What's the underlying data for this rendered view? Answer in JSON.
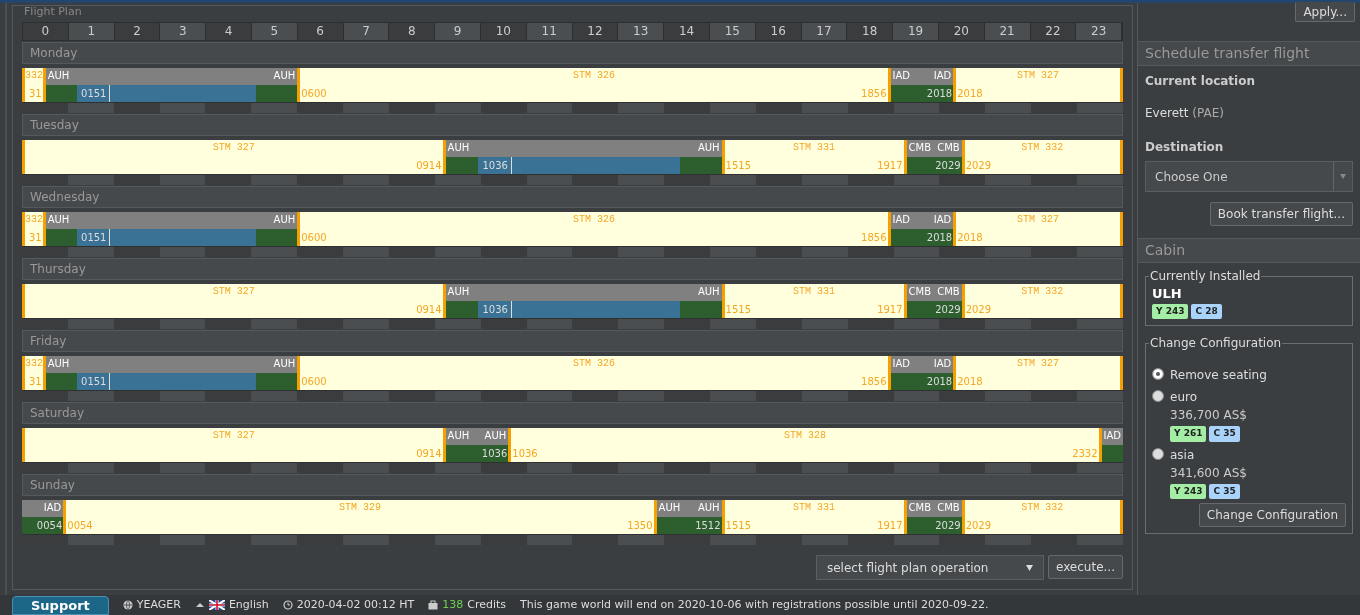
{
  "panel_title": "Flight Plan",
  "hours": [
    "0",
    "1",
    "2",
    "3",
    "4",
    "5",
    "6",
    "7",
    "8",
    "9",
    "10",
    "11",
    "12",
    "13",
    "14",
    "15",
    "16",
    "17",
    "18",
    "19",
    "20",
    "21",
    "22",
    "23"
  ],
  "days": [
    {
      "name": "Monday",
      "segments": [
        {
          "kind": "flight",
          "number": "332",
          "arrival": "31"
        },
        {
          "kind": "ground",
          "airport_in": "AUH",
          "airport_out": "AUH",
          "maintenance": "0151"
        },
        {
          "kind": "flight",
          "number": "STM 326",
          "departure": "0600",
          "arrival": "1856"
        },
        {
          "kind": "ground",
          "airport_in": "IAD",
          "airport_out": "IAD",
          "departure": "2018"
        },
        {
          "kind": "flight",
          "number": "STM 327",
          "departure": "2018"
        }
      ]
    },
    {
      "name": "Tuesday",
      "segments": [
        {
          "kind": "flight",
          "number": "STM 327",
          "arrival": "0914"
        },
        {
          "kind": "ground",
          "airport_in": "AUH",
          "airport_out": "AUH",
          "maintenance": "1036"
        },
        {
          "kind": "flight",
          "number": "STM 331",
          "departure": "1515",
          "arrival": "1917"
        },
        {
          "kind": "ground",
          "airport_in": "CMB",
          "airport_out": "CMB",
          "departure": "2029"
        },
        {
          "kind": "flight",
          "number": "STM 332",
          "departure": "2029"
        }
      ]
    },
    {
      "name": "Wednesday",
      "segments": [
        {
          "kind": "flight",
          "number": "332",
          "arrival": "31"
        },
        {
          "kind": "ground",
          "airport_in": "AUH",
          "airport_out": "AUH",
          "maintenance": "0151"
        },
        {
          "kind": "flight",
          "number": "STM 326",
          "departure": "0600",
          "arrival": "1856"
        },
        {
          "kind": "ground",
          "airport_in": "IAD",
          "airport_out": "IAD",
          "departure": "2018"
        },
        {
          "kind": "flight",
          "number": "STM 327",
          "departure": "2018"
        }
      ]
    },
    {
      "name": "Thursday",
      "segments": [
        {
          "kind": "flight",
          "number": "STM 327",
          "arrival": "0914"
        },
        {
          "kind": "ground",
          "airport_in": "AUH",
          "airport_out": "AUH",
          "maintenance": "1036"
        },
        {
          "kind": "flight",
          "number": "STM 331",
          "departure": "1515",
          "arrival": "1917"
        },
        {
          "kind": "ground",
          "airport_in": "CMB",
          "airport_out": "CMB",
          "departure": "2029"
        },
        {
          "kind": "flight",
          "number": "STM 332",
          "departure": "2029"
        }
      ]
    },
    {
      "name": "Friday",
      "segments": [
        {
          "kind": "flight",
          "number": "332",
          "arrival": "31"
        },
        {
          "kind": "ground",
          "airport_in": "AUH",
          "airport_out": "AUH",
          "maintenance": "0151"
        },
        {
          "kind": "flight",
          "number": "STM 326",
          "departure": "0600",
          "arrival": "1856"
        },
        {
          "kind": "ground",
          "airport_in": "IAD",
          "airport_out": "IAD",
          "departure": "2018"
        },
        {
          "kind": "flight",
          "number": "STM 327",
          "departure": "2018"
        }
      ]
    },
    {
      "name": "Saturday",
      "segments": [
        {
          "kind": "flight",
          "number": "STM 327",
          "arrival": "0914"
        },
        {
          "kind": "ground",
          "airport_in": "AUH",
          "airport_out": "AUH",
          "departure": "1036"
        },
        {
          "kind": "flight",
          "number": "STM 328",
          "departure": "1036",
          "arrival": "2332"
        },
        {
          "kind": "ground",
          "airport_in": "IAD"
        }
      ]
    },
    {
      "name": "Sunday",
      "segments": [
        {
          "kind": "ground",
          "airport_out": "IAD",
          "departure": "0054"
        },
        {
          "kind": "flight",
          "number": "STM 329",
          "departure": "0054",
          "arrival": "1350"
        },
        {
          "kind": "ground",
          "airport_in": "AUH",
          "airport_out": "AUH",
          "departure": "1512"
        },
        {
          "kind": "flight",
          "number": "STM 331",
          "departure": "1515",
          "arrival": "1917"
        },
        {
          "kind": "ground",
          "airport_in": "CMB",
          "airport_out": "CMB",
          "departure": "2029"
        },
        {
          "kind": "flight",
          "number": "STM 332",
          "departure": "2029"
        }
      ]
    }
  ],
  "operation_select": {
    "value": "select flight plan operation"
  },
  "execute_button": "execute...",
  "sidebar": {
    "apply_button": "Apply...",
    "transfer": {
      "title": "Schedule transfer flight",
      "location_label": "Current location",
      "location_city": "Everett",
      "location_code": "(PAE)",
      "destination_label": "Destination",
      "destination_select": "Choose One",
      "book_button": "Book transfer flight..."
    },
    "cabin": {
      "title": "Cabin",
      "installed_legend": "Currently Installed",
      "installed_name": "ULH",
      "installed_classes": [
        {
          "label": "Y 243",
          "color": "#a4eda4"
        },
        {
          "label": "C 28",
          "color": "#a9d3fa"
        }
      ],
      "change_legend": "Change Configuration",
      "options": [
        {
          "label": "Remove seating",
          "selected": true
        },
        {
          "label": "euro",
          "price": "336,700 AS$",
          "selected": false,
          "classes": [
            {
              "label": "Y 261",
              "color": "#a4eda4"
            },
            {
              "label": "C 35",
              "color": "#a9d3fa"
            }
          ]
        },
        {
          "label": "asia",
          "price": "341,600 AS$",
          "selected": false,
          "classes": [
            {
              "label": "Y 243",
              "color": "#a4eda4"
            },
            {
              "label": "C 35",
              "color": "#a9d3fa"
            }
          ]
        }
      ],
      "change_button": "Change Configuration"
    }
  },
  "status_bar": {
    "support_button": "Support",
    "user": "YEAGER",
    "language": "English",
    "clock": "2020-04-02 00:12 HT",
    "credits_count": "138",
    "credits_label": "Credits",
    "message": "This game world will end on 2020-10-06 with registrations possible until 2020-09-22."
  }
}
